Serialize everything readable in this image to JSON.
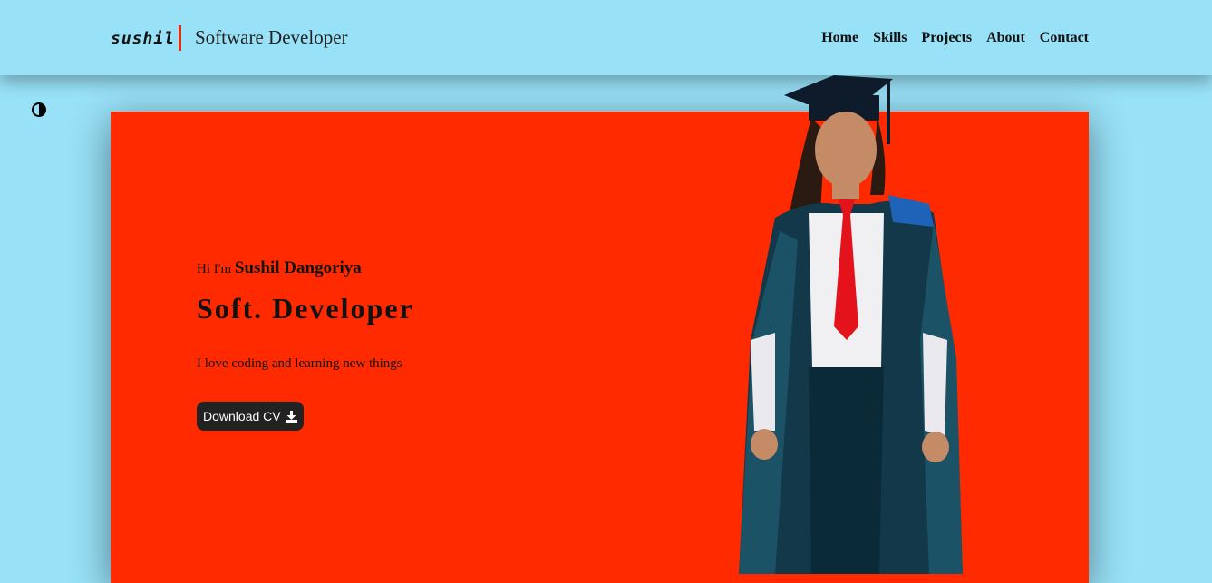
{
  "header": {
    "logo_text": "sushil",
    "tagline": "Software Developer",
    "nav": [
      "Home",
      "Skills",
      "Projects",
      "About",
      "Contact"
    ]
  },
  "hero": {
    "greeting_prefix": "Hi I'm ",
    "name": "Sushil Dangoriya",
    "role": "Soft. Developer",
    "description": "I love coding and learning new things",
    "cv_button": "Download CV"
  },
  "colors": {
    "background": "#98e1f7",
    "hero": "#ff2a00",
    "button": "#222222",
    "logo_accent": "#e03010"
  },
  "icons": {
    "theme_toggle": "half-circle-contrast-icon",
    "download": "download-icon"
  }
}
